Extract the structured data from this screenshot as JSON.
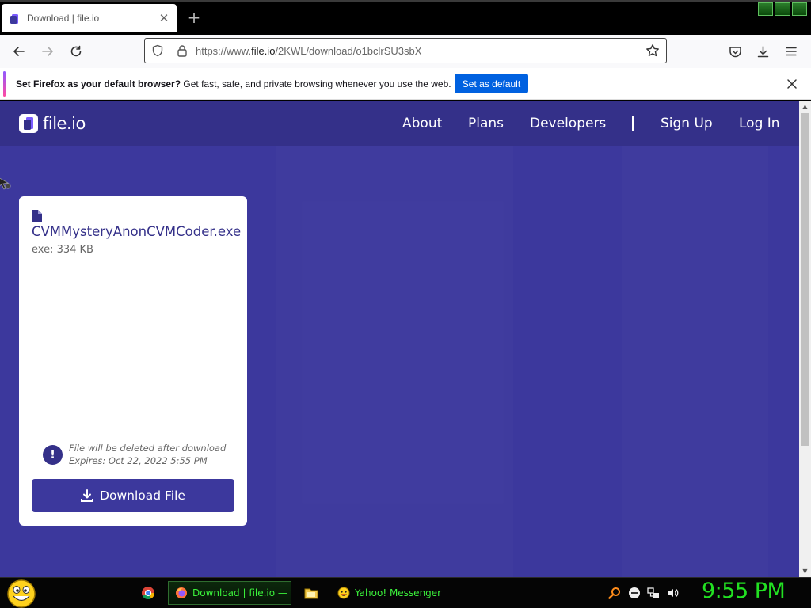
{
  "browser": {
    "tab": {
      "title": "Download | file.io",
      "close_glyph": "✕"
    },
    "new_tab_glyph": "+",
    "url": {
      "scheme": "https://www.",
      "host": "file.io",
      "path": "/2KWL/download/o1bclrSU3sbX"
    },
    "notification": {
      "bold_text": "Set Firefox as your default browser?",
      "text": " Get fast, safe, and private browsing whenever you use the web.",
      "button_label": "Set as default"
    },
    "icons": {
      "back": "arrow-left-icon",
      "forward": "arrow-right-icon",
      "reload": "reload-icon",
      "tracking": "shield-icon",
      "lock": "lock-icon",
      "bookmark": "star-icon",
      "pocket": "pocket-icon",
      "downloads": "download-icon",
      "menu": "hamburger-menu-icon"
    }
  },
  "site": {
    "logo_text": "file.io",
    "nav": {
      "about": "About",
      "plans": "Plans",
      "developers": "Developers",
      "signup": "Sign Up",
      "login": "Log In"
    },
    "file": {
      "name": "CVMMysteryAnonCVMCoder.exe",
      "meta": "exe; 334 KB",
      "notice_line1": "File will be deleted after download",
      "notice_line2": "Expires: Oct 22, 2022 5:55 PM",
      "notice_glyph": "!",
      "download_label": "Download File"
    },
    "colors": {
      "page_bg": "#3c389d",
      "header_bg": "#343089",
      "accent": "#343089"
    }
  },
  "taskbar": {
    "tasks": {
      "firefox": "Download | file.io — ...",
      "yahoo": "Yahoo! Messenger"
    },
    "clock": "9:55 PM",
    "colors": {
      "text": "#3bf23b",
      "clock": "#22e022"
    }
  }
}
